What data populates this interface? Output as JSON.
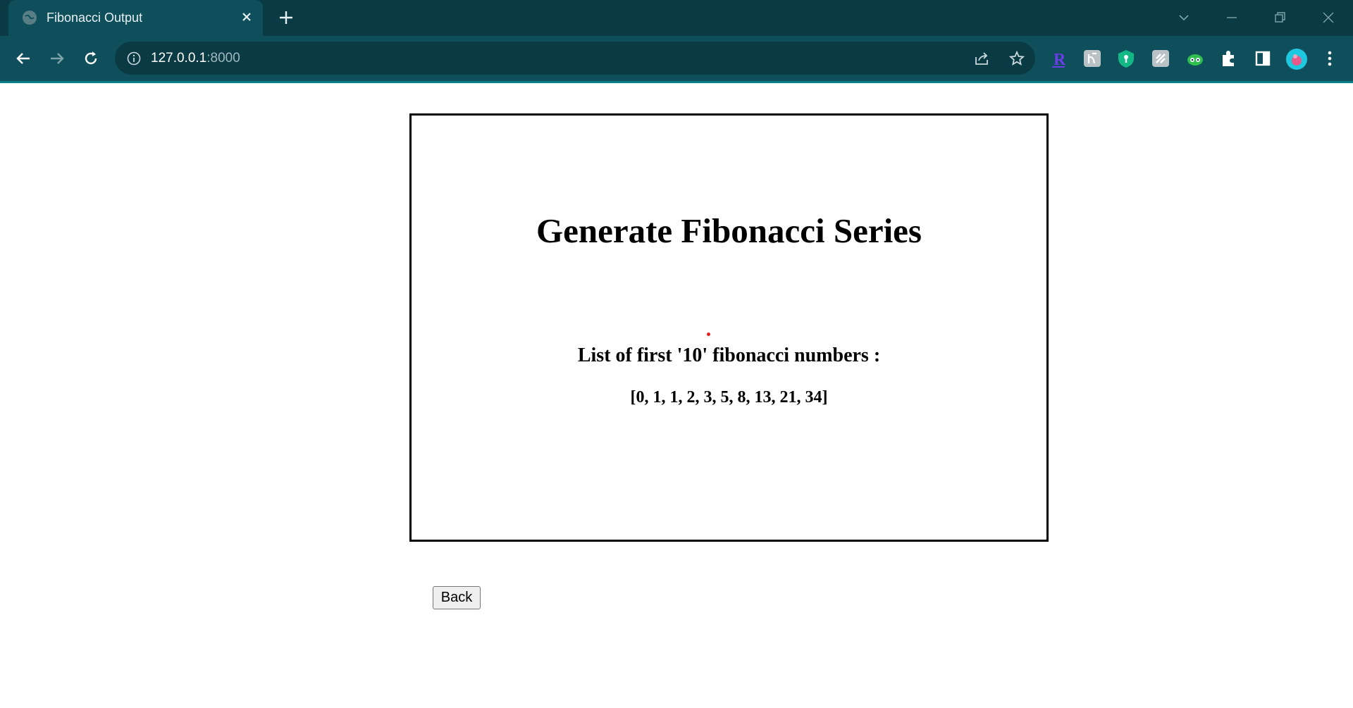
{
  "browser": {
    "tab_title": "Fibonacci Output",
    "url_host": "127.0.0.1",
    "url_port": ":8000",
    "icons": {
      "tab_favicon": "globe-icon",
      "tab_close": "close-icon",
      "new_tab": "plus-icon",
      "back": "arrow-left-icon",
      "forward": "arrow-right-icon",
      "reload": "reload-icon",
      "site_info": "info-icon",
      "share": "share-icon",
      "bookmark": "star-icon",
      "extensions": "puzzle-icon",
      "side_panel": "side-panel-icon",
      "menu": "kebab-menu-icon"
    },
    "colors": {
      "tabstrip": "#0a3b44",
      "toolbar": "#0f4f5b",
      "accent": "#0a7d86"
    }
  },
  "page": {
    "heading": "Generate Fibonacci Series",
    "list_label": "List of first '10' fibonacci numbers :",
    "fibonacci_output": "[0, 1, 1, 2, 3, 5, 8, 13, 21, 34]",
    "back_label": "Back"
  }
}
